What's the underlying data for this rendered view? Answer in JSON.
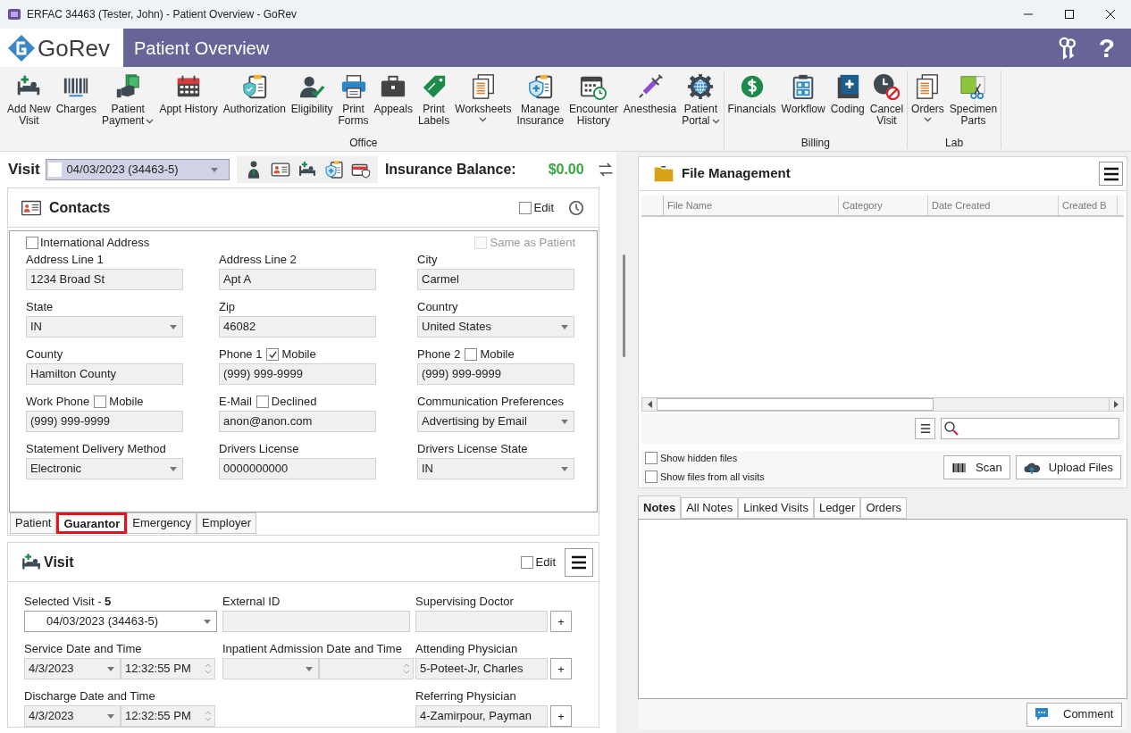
{
  "window": {
    "title": "ERFAC 34463 (Tester, John) - Patient Overview - GoRev"
  },
  "header": {
    "app_name": "GoRev",
    "page_title": "Patient Overview",
    "help": "?"
  },
  "toolbar": {
    "groups": [
      {
        "label": "Office",
        "buttons": [
          {
            "lines": [
              "Add New",
              "Visit"
            ],
            "dropdown": false
          },
          {
            "lines": [
              "Charges"
            ],
            "dropdown": false
          },
          {
            "lines": [
              "Patient",
              "Payment"
            ],
            "dropdown": true
          },
          {
            "lines": [
              "Appt History"
            ],
            "dropdown": false
          },
          {
            "lines": [
              "Authorization"
            ],
            "dropdown": false
          },
          {
            "lines": [
              "Eligibility"
            ],
            "dropdown": false
          },
          {
            "lines": [
              "Print",
              "Forms"
            ],
            "dropdown": false
          },
          {
            "lines": [
              "Appeals"
            ],
            "dropdown": false
          },
          {
            "lines": [
              "Print",
              "Labels"
            ],
            "dropdown": false
          },
          {
            "lines": [
              "Worksheets"
            ],
            "dropdown": true
          },
          {
            "lines": [
              "Manage",
              "Insurance"
            ],
            "dropdown": false
          },
          {
            "lines": [
              "Encounter",
              "History"
            ],
            "dropdown": false
          },
          {
            "lines": [
              "Anesthesia"
            ],
            "dropdown": false
          },
          {
            "lines": [
              "Patient",
              "Portal"
            ],
            "dropdown": true
          }
        ]
      },
      {
        "label": "Billing",
        "buttons": [
          {
            "lines": [
              "Financials"
            ],
            "dropdown": false
          },
          {
            "lines": [
              "Workflow"
            ],
            "dropdown": false
          },
          {
            "lines": [
              "Coding"
            ],
            "dropdown": false
          },
          {
            "lines": [
              "Cancel",
              "Visit"
            ],
            "dropdown": false
          }
        ]
      },
      {
        "label": "Lab",
        "buttons": [
          {
            "lines": [
              "Orders"
            ],
            "dropdown": true
          },
          {
            "lines": [
              "Specimen",
              "Parts"
            ],
            "dropdown": false
          }
        ]
      }
    ]
  },
  "visit_bar": {
    "label": "Visit",
    "selected_visit": "04/03/2023 (34463-5)",
    "balance_label": "Insurance Balance:",
    "balance": "$0.00"
  },
  "contacts": {
    "title": "Contacts",
    "edit": {
      "label": "Edit",
      "checked": false
    },
    "international_address": {
      "label": "International Address",
      "checked": false
    },
    "same_as_patient": {
      "label": "Same as Patient",
      "checked": false,
      "disabled": true
    },
    "fields": [
      {
        "label": "Address Line 1",
        "kind": "text",
        "value": "1234 Broad St"
      },
      {
        "label": "Address Line 2",
        "kind": "text",
        "value": "Apt A"
      },
      {
        "label": "City",
        "kind": "text",
        "value": "Carmel"
      },
      {
        "label": "State",
        "kind": "select",
        "value": "IN"
      },
      {
        "label": "Zip",
        "kind": "text",
        "value": "46082"
      },
      {
        "label": "Country",
        "kind": "select",
        "value": "United States"
      },
      {
        "label": "County",
        "kind": "text",
        "value": "Hamilton County"
      },
      {
        "label": "Phone 1",
        "kind": "text",
        "value": "(999) 999-9999",
        "option": {
          "label": "Mobile",
          "checked": true
        }
      },
      {
        "label": "Phone 2",
        "kind": "text",
        "value": "(999) 999-9999",
        "option": {
          "label": "Mobile",
          "checked": false
        }
      },
      {
        "label": "Work Phone",
        "kind": "text",
        "value": "(999) 999-9999",
        "option": {
          "label": "Mobile",
          "checked": false
        }
      },
      {
        "label": "E-Mail",
        "kind": "text",
        "value": "anon@anon.com",
        "option": {
          "label": "Declined",
          "checked": false
        }
      },
      {
        "label": "Communication Preferences",
        "kind": "select",
        "value": "Advertising by Email"
      },
      {
        "label": "Statement Delivery Method",
        "kind": "select",
        "value": "Electronic"
      },
      {
        "label": "Drivers License",
        "kind": "text",
        "value": "0000000000"
      },
      {
        "label": "Drivers License State",
        "kind": "select",
        "value": "IN"
      }
    ],
    "tabs": [
      {
        "label": "Patient",
        "selected": false,
        "highlighted": false
      },
      {
        "label": "Guarantor",
        "selected": true,
        "highlighted": true
      },
      {
        "label": "Emergency",
        "selected": false,
        "highlighted": false
      },
      {
        "label": "Employer",
        "selected": false,
        "highlighted": false
      }
    ]
  },
  "visit_panel": {
    "title": "Visit",
    "edit": {
      "label": "Edit",
      "checked": false
    },
    "columns": [
      [
        {
          "label": "Selected Visit - **5**",
          "kind": "visit-select",
          "value": "04/03/2023 (34463-5)"
        },
        {
          "label": "Service Date and Time",
          "kind": "datetime",
          "date": "4/3/2023",
          "time": "12:32:55 PM"
        },
        {
          "label": "Discharge Date and Time",
          "kind": "datetime",
          "date": "4/3/2023",
          "time": "12:32:55 PM"
        }
      ],
      [
        {
          "label": "External ID",
          "kind": "text"
        },
        {
          "label": "Inpatient Admission Date and Time",
          "kind": "datetime"
        }
      ],
      [
        {
          "label": "Supervising Doctor",
          "kind": "text-add",
          "add": "+"
        },
        {
          "label": "Attending Physician",
          "kind": "text-add",
          "value": "5-Poteet-Jr, Charles",
          "add": "+"
        },
        {
          "label": "Referring Physician",
          "kind": "text-add",
          "value": "4-Zamirpour, Payman",
          "add": "+"
        }
      ]
    ]
  },
  "file_management": {
    "title": "File Management",
    "columns": [
      "File Name",
      "Category",
      "Date Created",
      "Created B"
    ],
    "options": [
      {
        "label": "Show hidden files",
        "checked": false
      },
      {
        "label": "Show files from all visits",
        "checked": false
      }
    ],
    "buttons": [
      "Scan",
      "Upload Files"
    ]
  },
  "notes": {
    "tabs": [
      {
        "label": "Notes",
        "selected": true
      },
      {
        "label": "All Notes",
        "selected": false
      },
      {
        "label": "Linked Visits",
        "selected": false
      },
      {
        "label": "Ledger",
        "selected": false
      },
      {
        "label": "Orders",
        "selected": false
      }
    ],
    "comment_button": "Comment"
  }
}
